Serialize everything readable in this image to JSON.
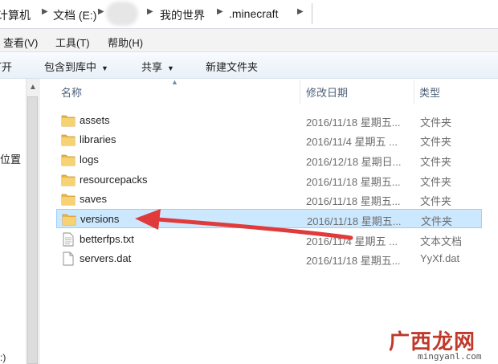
{
  "address": {
    "crumbs": [
      "计算机",
      "文档 (E:)",
      "我的世界",
      ".minecraft"
    ]
  },
  "menu": {
    "items": [
      "查看(V)",
      "工具(T)",
      "帮助(H)"
    ]
  },
  "toolbar": {
    "open": "打开",
    "include": "包含到库中",
    "share": "共享",
    "new_folder": "新建文件夹"
  },
  "nav": {
    "location": "位置",
    "drive": ":)"
  },
  "columns": {
    "name": "名称",
    "date": "修改日期",
    "type": "类型"
  },
  "files": [
    {
      "name": "assets",
      "date": "2016/11/18 星期五...",
      "type": "文件夹",
      "icon": "folder-icon"
    },
    {
      "name": "libraries",
      "date": "2016/11/4 星期五 ...",
      "type": "文件夹",
      "icon": "folder-icon"
    },
    {
      "name": "logs",
      "date": "2016/12/18 星期日...",
      "type": "文件夹",
      "icon": "folder-icon"
    },
    {
      "name": "resourcepacks",
      "date": "2016/11/18 星期五...",
      "type": "文件夹",
      "icon": "folder-icon"
    },
    {
      "name": "saves",
      "date": "2016/11/18 星期五...",
      "type": "文件夹",
      "icon": "folder-icon"
    },
    {
      "name": "versions",
      "date": "2016/11/18 星期五...",
      "type": "文件夹",
      "icon": "folder-icon",
      "selected": true
    },
    {
      "name": "betterfps.txt",
      "date": "2016/11/4 星期五 ...",
      "type": "文本文档",
      "icon": "text-file-icon"
    },
    {
      "name": "servers.dat",
      "date": "2016/11/18 星期五...",
      "type": "YyXf.dat",
      "icon": "file-icon"
    }
  ],
  "watermark": {
    "main": "广西龙网",
    "sub": "mingyanl.com"
  },
  "colors": {
    "selection": "#cce8ff",
    "arrow": "#e03a3a",
    "watermark": "#c0392b"
  }
}
